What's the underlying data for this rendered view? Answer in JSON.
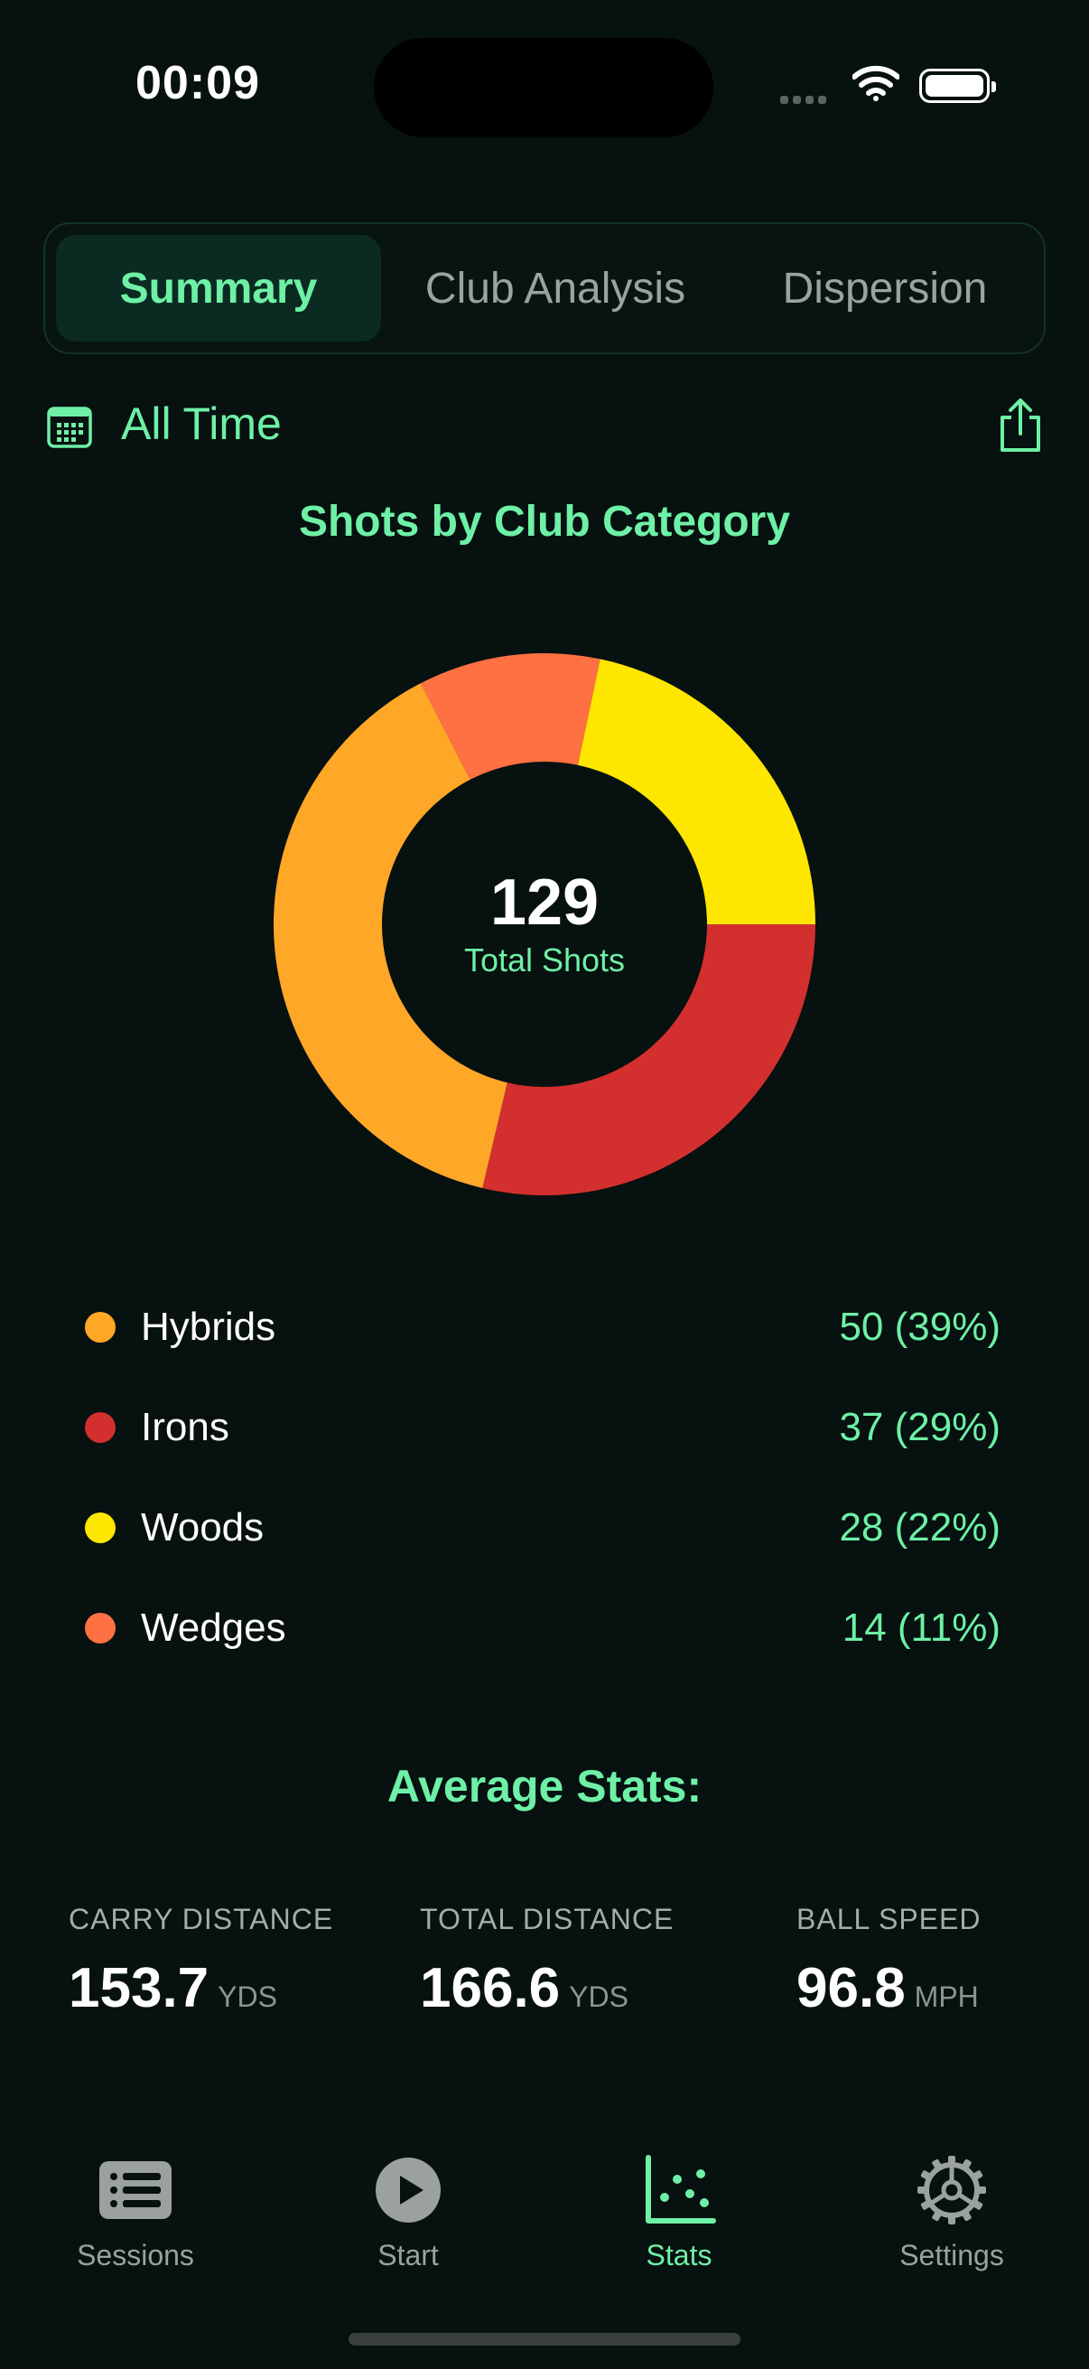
{
  "status_bar": {
    "time": "00:09"
  },
  "segmented": {
    "tabs": [
      "Summary",
      "Club Analysis",
      "Dispersion"
    ],
    "active": 0
  },
  "filter": {
    "label": "All Time"
  },
  "chart_data": {
    "type": "pie",
    "title": "Shots by Club Category",
    "center_value": "129",
    "center_label": "Total Shots",
    "categories": [
      "Hybrids",
      "Irons",
      "Woods",
      "Wedges"
    ],
    "values": [
      50,
      37,
      28,
      14
    ],
    "value_labels": [
      "50 (39%)",
      "37 (29%)",
      "28 (22%)",
      "14 (11%)"
    ],
    "colors": [
      "#FFA726",
      "#D32F2F",
      "#FFE600",
      "#FF7043"
    ]
  },
  "average_stats": {
    "title": "Average Stats:",
    "items": [
      {
        "label": "CARRY DISTANCE",
        "value": "153.7",
        "unit": "YDS"
      },
      {
        "label": "TOTAL DISTANCE",
        "value": "166.6",
        "unit": "YDS"
      },
      {
        "label": "BALL SPEED",
        "value": "96.8",
        "unit": "MPH"
      }
    ]
  },
  "tab_bar": {
    "items": [
      {
        "label": "Sessions",
        "icon": "list-icon"
      },
      {
        "label": "Start",
        "icon": "play-icon"
      },
      {
        "label": "Stats",
        "icon": "scatter-chart-icon"
      },
      {
        "label": "Settings",
        "icon": "gear-icon"
      }
    ],
    "active": 2
  },
  "colors": {
    "accent": "#6EF0A6",
    "background": "#061110"
  }
}
